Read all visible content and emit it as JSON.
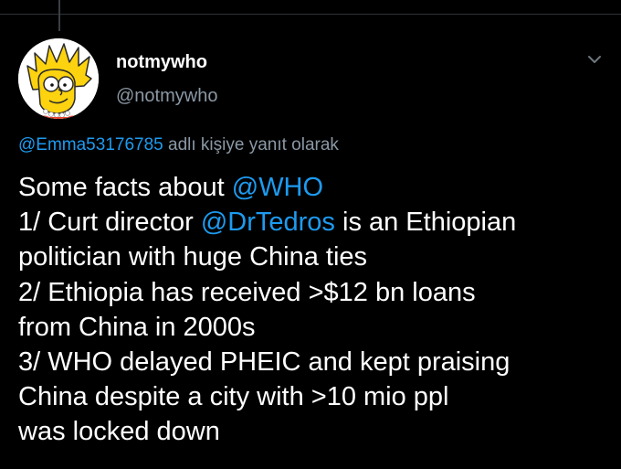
{
  "author": {
    "display_name": "notmywho",
    "handle": "@notmywho"
  },
  "reply_context": {
    "mention": "@Emma53176785",
    "suffix": " adlı kişiye yanıt olarak"
  },
  "tweet": {
    "line1": {
      "text": "Some facts about ",
      "mention": "@WHO"
    },
    "line2": {
      "prefix": "1/ Curt director ",
      "mention": "@DrTedros",
      "suffix": " is an Ethiopian"
    },
    "line3": "politician with huge China ties",
    "line4": "2/ Ethiopia has received >$12 bn loans",
    "line5": "from China in 2000s",
    "line6": "3/ WHO delayed PHEIC and kept praising",
    "line7": "China despite a city with >10 mio ppl",
    "line8": "was locked down"
  },
  "icons": {
    "avatar": "cartoon-character-avatar",
    "menu": "chevron-down-icon"
  },
  "colors": {
    "background": "#000000",
    "text": "#ffffff",
    "secondary_text": "#8b98a5",
    "link": "#1d9bf0"
  }
}
